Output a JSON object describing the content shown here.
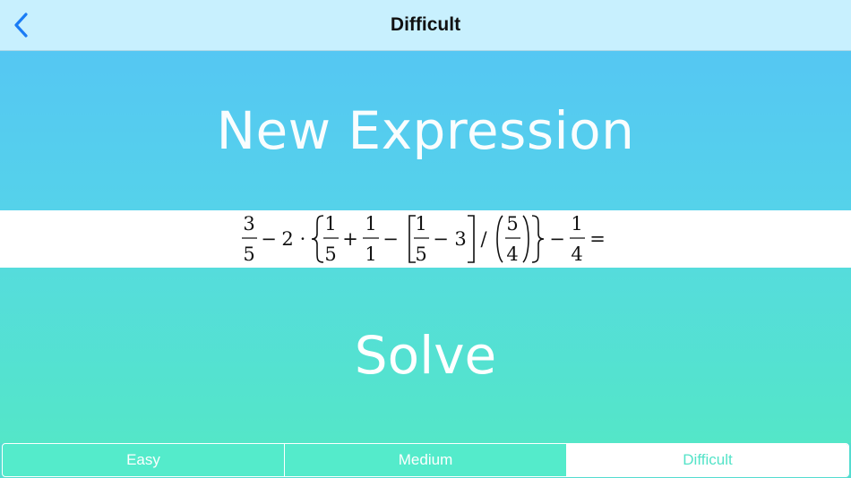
{
  "nav": {
    "title": "Difficult",
    "back_icon": "chevron-left-icon",
    "accent": "#1a7cf5"
  },
  "main": {
    "new_expression_label": "New Expression",
    "solve_label": "Solve"
  },
  "expression": {
    "text": "3/5 − 2 · {1/5 + 1/1 − [1/5 − 3]/(5/4)} − 1/4 =",
    "f1_num": "3",
    "f1_den": "5",
    "minus": "−",
    "two": "2",
    "cdot": "·",
    "f2_num": "1",
    "f2_den": "5",
    "plus": "+",
    "f3_num": "1",
    "f3_den": "1",
    "f4_num": "1",
    "f4_den": "5",
    "three": "3",
    "slash": "/",
    "f5_num": "5",
    "f5_den": "4",
    "f6_num": "1",
    "f6_den": "4",
    "equals": "="
  },
  "segments": {
    "items": [
      "Easy",
      "Medium",
      "Difficult"
    ],
    "selected": "Difficult"
  }
}
